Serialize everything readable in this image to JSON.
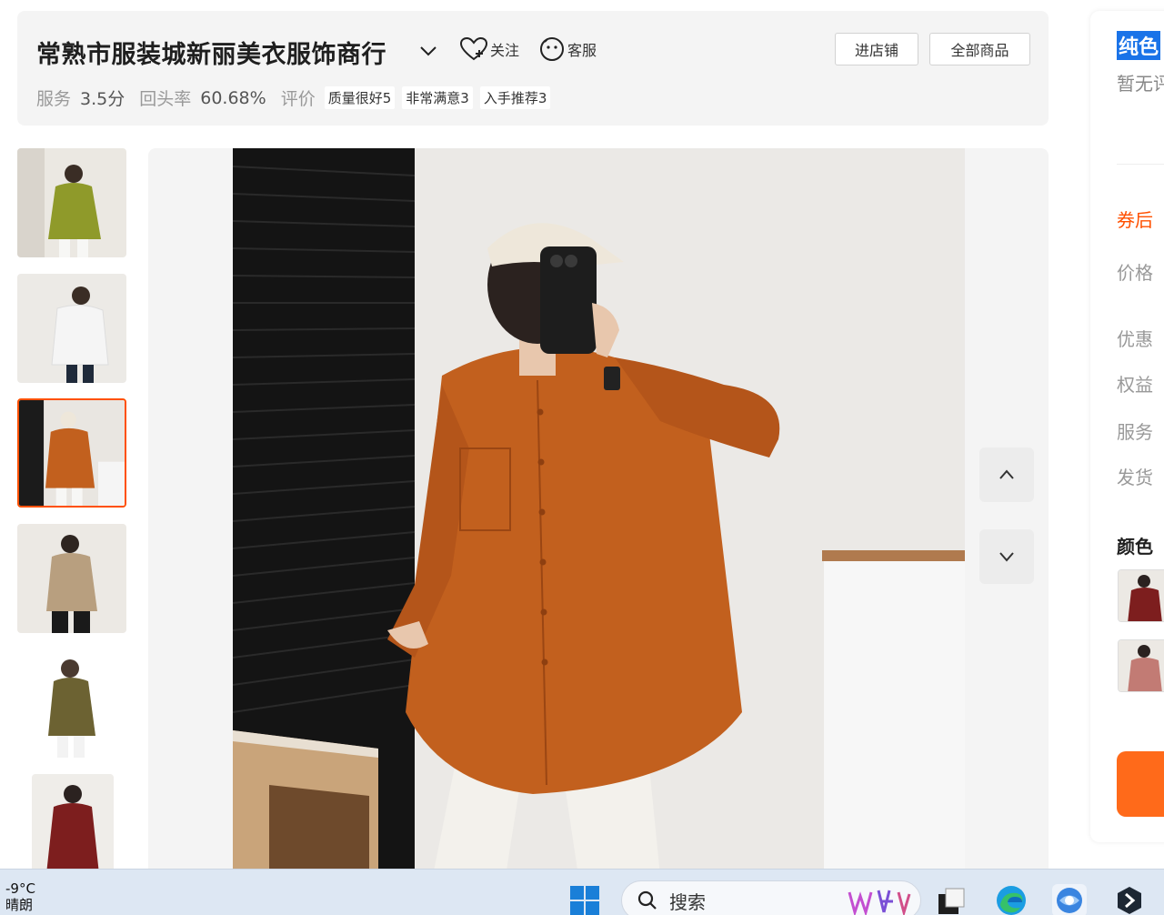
{
  "shop": {
    "name": "常熟市服装城新丽美衣服饰商行",
    "follow_label": "关注",
    "service_label": "客服",
    "enter_store_label": "进店铺",
    "all_products_label": "全部商品"
  },
  "stats": {
    "service_label": "服务",
    "service_value": "3.5分",
    "repurchase_label": "回头率",
    "repurchase_value": "60.68%",
    "review_label": "评价",
    "tags": [
      "质量很好5",
      "非常满意3",
      "入手推荐3"
    ]
  },
  "gallery": {
    "thumbnails": [
      {
        "name": "olive shirt",
        "color": "#8f9a2a"
      },
      {
        "name": "white shirt",
        "color": "#f1f1f1"
      },
      {
        "name": "orange shirt",
        "color": "#c2601e"
      },
      {
        "name": "khaki shirt",
        "color": "#b89f7f"
      },
      {
        "name": "army green shirt",
        "color": "#6c6232"
      },
      {
        "name": "burgundy shirt",
        "color": "#7d1e1e"
      }
    ],
    "active_index": 2
  },
  "product_panel": {
    "title": "纯色",
    "no_review": "暂无评",
    "labels": {
      "after_coupon": "券后",
      "price": "价格",
      "discount": "优惠",
      "benefits": "权益",
      "service": "服务",
      "shipping": "发货",
      "color": "颜色"
    },
    "accent_color": "#ff5000"
  },
  "taskbar": {
    "temperature": "-9°C",
    "weather": "晴朗",
    "search_label": "搜索"
  }
}
